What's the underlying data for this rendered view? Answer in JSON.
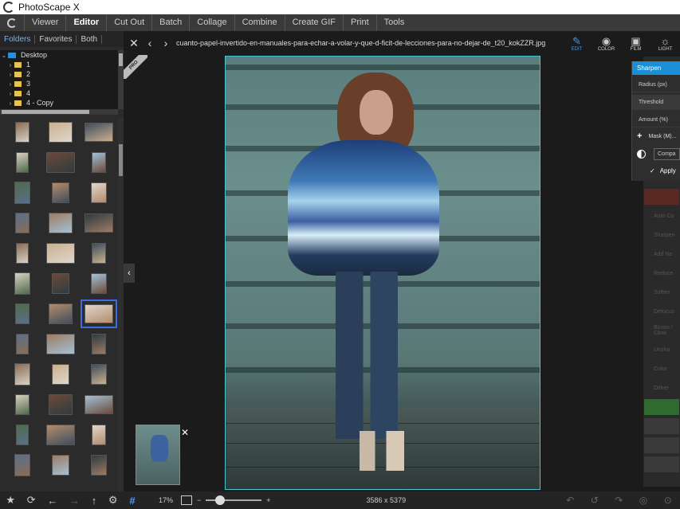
{
  "app": {
    "title": "PhotoScape X"
  },
  "menu": {
    "items": [
      "Viewer",
      "Editor",
      "Cut Out",
      "Batch",
      "Collage",
      "Combine",
      "Create GIF",
      "Print",
      "Tools"
    ],
    "active": "Editor"
  },
  "left": {
    "tabs": [
      "Folders",
      "Favorites",
      "Both"
    ],
    "tree": [
      {
        "label": "Desktop",
        "expanded": true,
        "color": "blue"
      },
      {
        "label": "1"
      },
      {
        "label": "2"
      },
      {
        "label": "3"
      },
      {
        "label": "4"
      },
      {
        "label": "4 - Copy"
      }
    ]
  },
  "center": {
    "filename": "cuanto-papel-invertido-en-manuales-para-echar-a-volar-y-que-d-ficit-de-lecciones-para-no-dejar-de_t20_kokZZR.jpg",
    "pro_badge": "PRO",
    "zoom": "17%",
    "dimensions": "3586 x 5379",
    "zoom_slider_fraction": 0.2
  },
  "modes": [
    {
      "label": "EDIT",
      "icon": "edit-icon",
      "active": true
    },
    {
      "label": "COLOR",
      "icon": "color-icon"
    },
    {
      "label": "FILM",
      "icon": "film-icon"
    },
    {
      "label": "LIGHT",
      "icon": "light-icon"
    }
  ],
  "sharpen": {
    "title": "Sharpen",
    "radius": "Radius (px)",
    "threshold": "Threshold",
    "amount": "Amount (%)",
    "mask": "Mask (M)...",
    "compare": "Compa",
    "apply": "Apply"
  },
  "tool_labels": [
    "Auto Co",
    "Sharpen",
    "Add No",
    "Reduce",
    "Soften",
    "Defocus",
    "Bloom / Glow",
    "Unsha",
    "Color",
    "Dither"
  ],
  "colors": {
    "accent": "#1b8ed6",
    "selection": "#3b6de0",
    "photo_border": "#4cc4cf"
  }
}
